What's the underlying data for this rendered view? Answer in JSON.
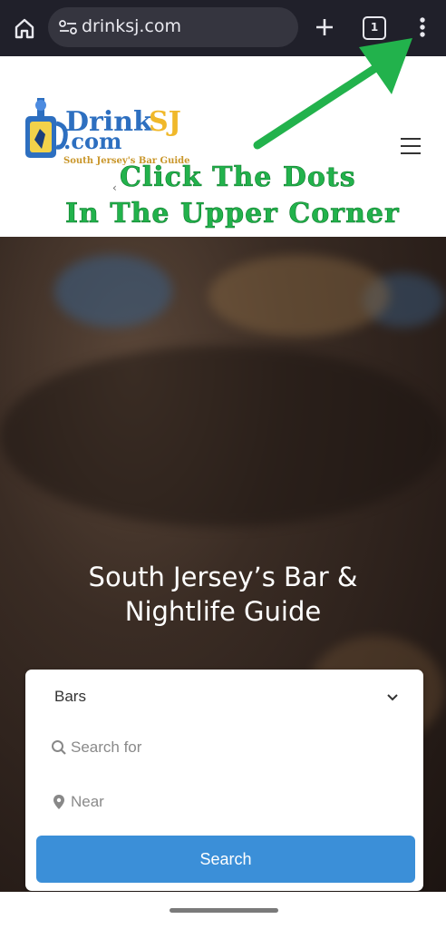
{
  "browser": {
    "url": "drinksj.com",
    "tab_count": "1",
    "icons": [
      "home-icon",
      "site-settings-icon",
      "plus-icon",
      "tab-switcher-icon",
      "more-vert-icon"
    ]
  },
  "header": {
    "logo_text": "DrinkSJ",
    "logo_sub": ".com",
    "logo_tagline": "South Jersey's Bar Guide",
    "small_char": "‹"
  },
  "annotation": {
    "line1": "Click The Dots",
    "line2": "In The Upper Corner",
    "color": "#22b24c"
  },
  "hero": {
    "title_line1": "South Jersey’s Bar &",
    "title_line2": "Nightlife Guide"
  },
  "search": {
    "category_value": "Bars",
    "search_placeholder": "Search for",
    "near_placeholder": "Near",
    "button_label": "Search",
    "button_color": "#3b8fd8"
  }
}
